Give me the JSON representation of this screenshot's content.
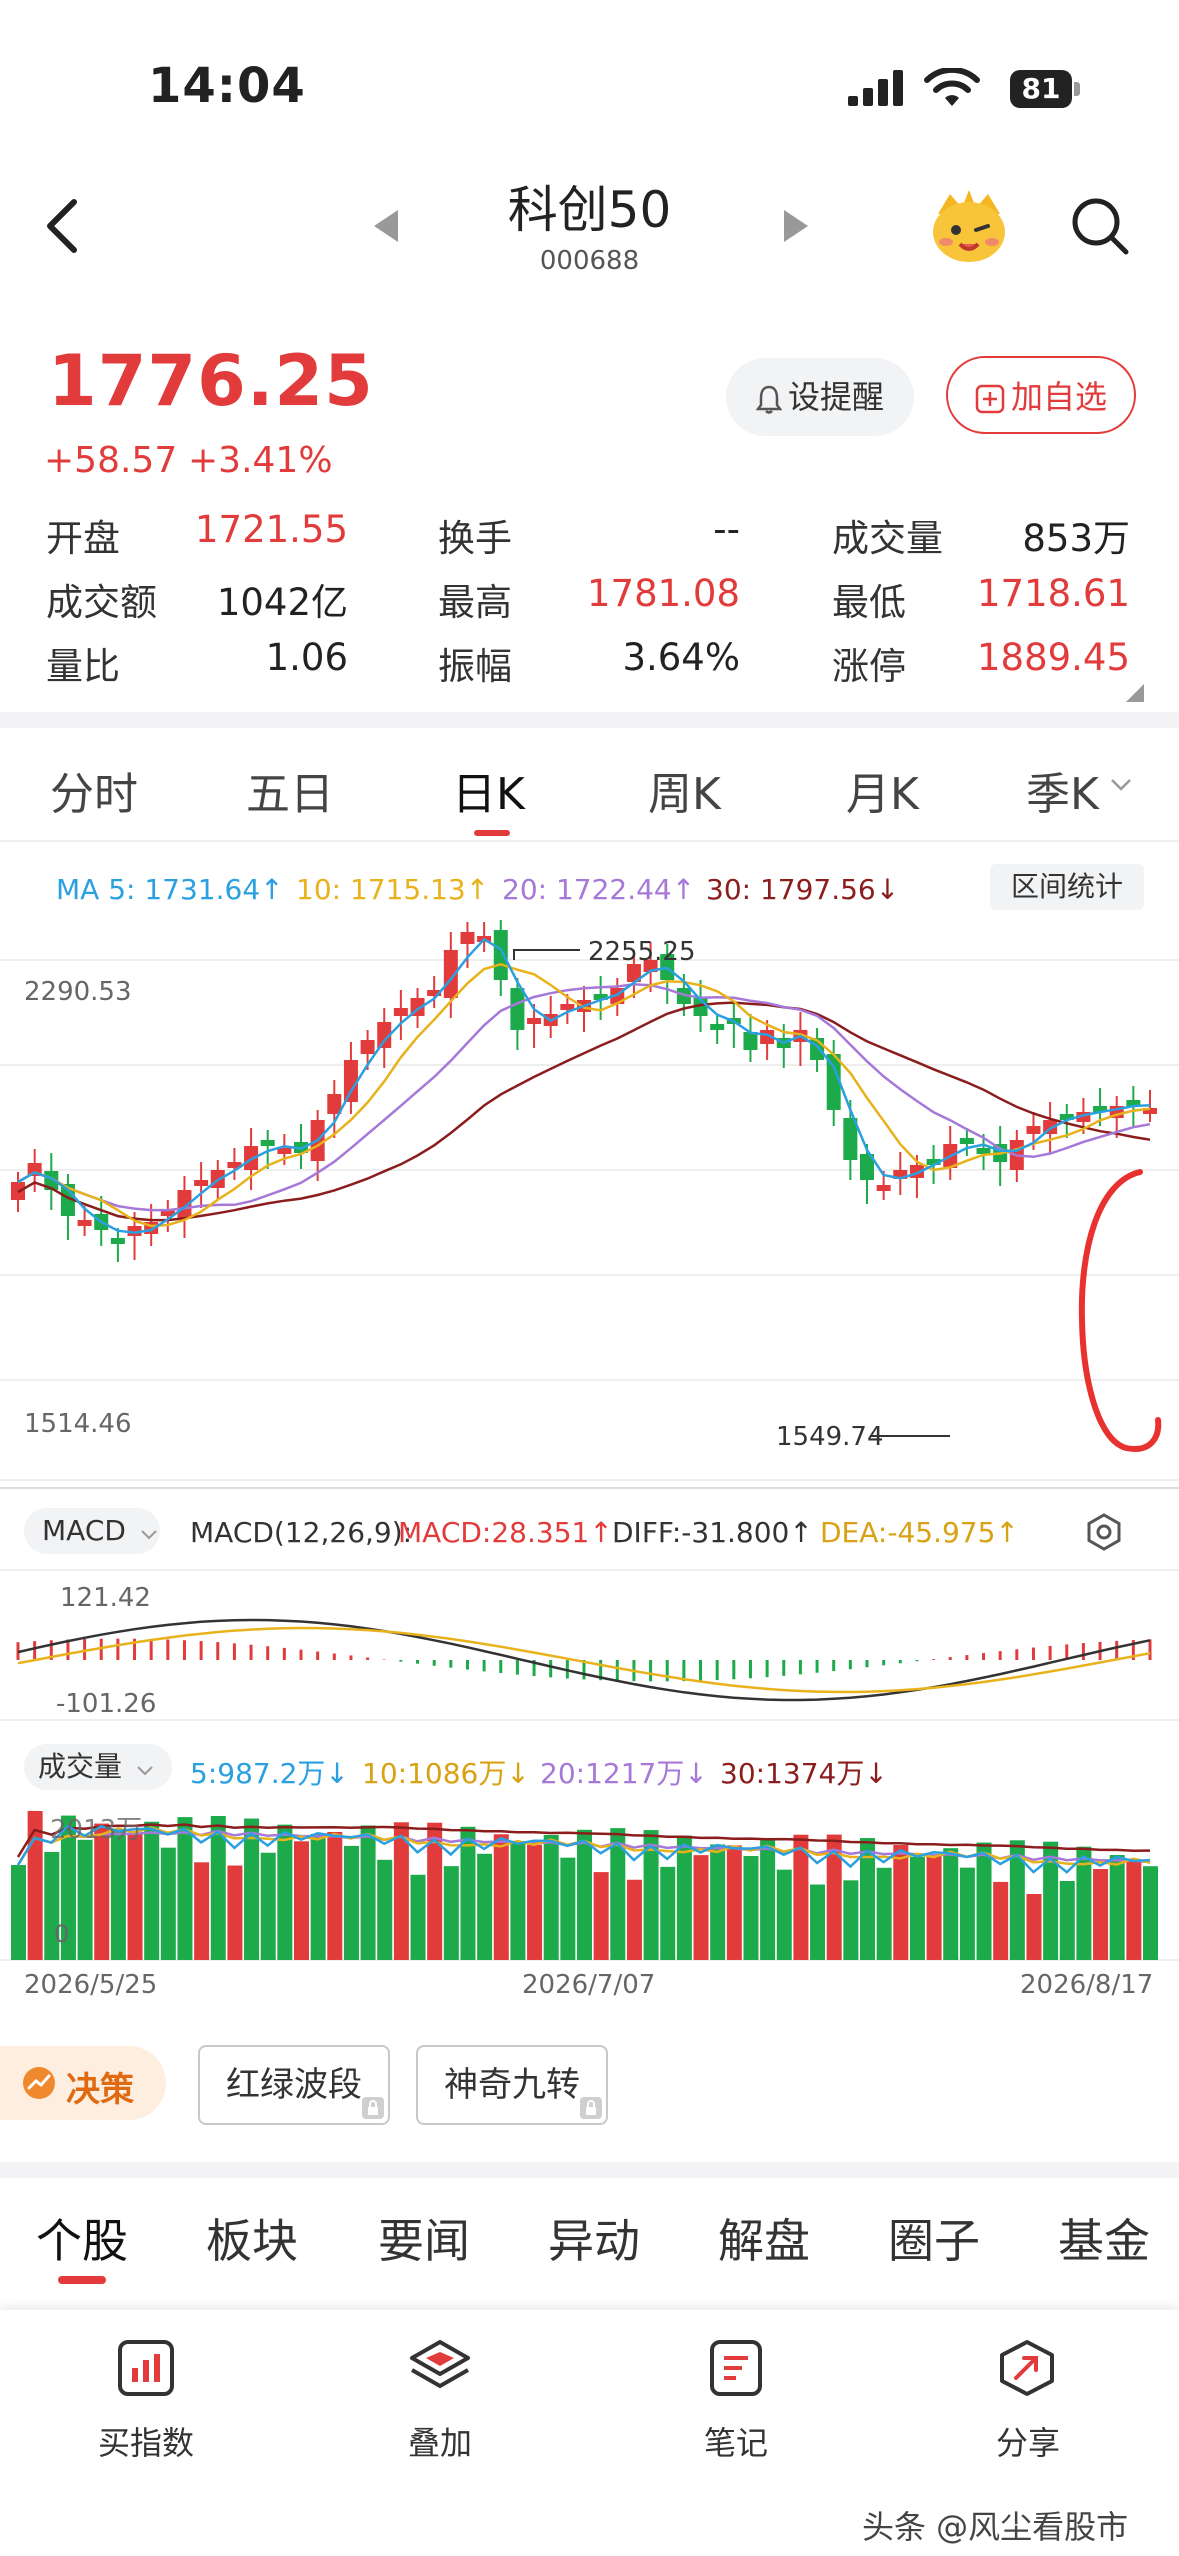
{
  "status_bar": {
    "time": "14:04",
    "battery": "81"
  },
  "header": {
    "title": "科创50",
    "code": "000688"
  },
  "quote": {
    "price": "1776.25",
    "change": "+58.57",
    "change_pct": "+3.41%",
    "set_alert": "设提醒",
    "add_watch": "加自选"
  },
  "stats": [
    {
      "label": "开盘",
      "value": "1721.55",
      "color": "red"
    },
    {
      "label": "换手",
      "value": "--",
      "color": "dark"
    },
    {
      "label": "成交量",
      "value": "853万",
      "color": "dark"
    },
    {
      "label": "成交额",
      "value": "1042亿",
      "color": "dark"
    },
    {
      "label": "最高",
      "value": "1781.08",
      "color": "red"
    },
    {
      "label": "最低",
      "value": "1718.61",
      "color": "red"
    },
    {
      "label": "量比",
      "value": "1.06",
      "color": "dark"
    },
    {
      "label": "振幅",
      "value": "3.64%",
      "color": "dark"
    },
    {
      "label": "涨停",
      "value": "1889.45",
      "color": "red"
    }
  ],
  "chart_tabs": [
    "分时",
    "五日",
    "日K",
    "周K",
    "月K",
    "季K"
  ],
  "active_tab": "日K",
  "ma_legend": {
    "ma5": "MA 5: 1731.64↑",
    "ma10": "10: 1715.13↑",
    "ma20": "20: 1722.44↑",
    "ma30": "30: 1797.56↓",
    "range_stats": "区间统计"
  },
  "kline": {
    "y_top_label": "2290.53",
    "y_bottom_label": "1514.46",
    "high_marker": "2255.25",
    "low_marker": "1549.74"
  },
  "macd": {
    "selector": "MACD",
    "params": "MACD(12,26,9):",
    "macd": "MACD:28.351↑",
    "diff": "DIFF:-31.800↑",
    "dea": "DEA:-45.975↑",
    "y_top": "121.42",
    "y_bottom": "-101.26"
  },
  "volume": {
    "selector": "成交量",
    "v5": "5:987.2万↓",
    "v10": "10:1086万↓",
    "v20": "20:1217万↓",
    "v30": "30:1374万↓",
    "y_top": "2013万",
    "y_bottom": "0"
  },
  "x_axis": [
    "2026/5/25",
    "2026/7/07",
    "2026/8/17"
  ],
  "strategy": {
    "label": "决策",
    "chip1": "红绿波段",
    "chip2": "神奇九转"
  },
  "bottom_tabs": [
    "个股",
    "板块",
    "要闻",
    "异动",
    "解盘",
    "圈子",
    "基金"
  ],
  "bottom_nav": [
    "买指数",
    "叠加",
    "笔记",
    "分享"
  ],
  "watermark": "头条 @风尘看股市",
  "colors": {
    "up": "#e23b3b",
    "down": "#1daa4a",
    "ma5": "#2aa0e0",
    "ma10": "#e8b21b",
    "ma20": "#a678d8",
    "ma30": "#8b1d1d",
    "dif": "#333333",
    "dea": "#e8b21b"
  }
}
